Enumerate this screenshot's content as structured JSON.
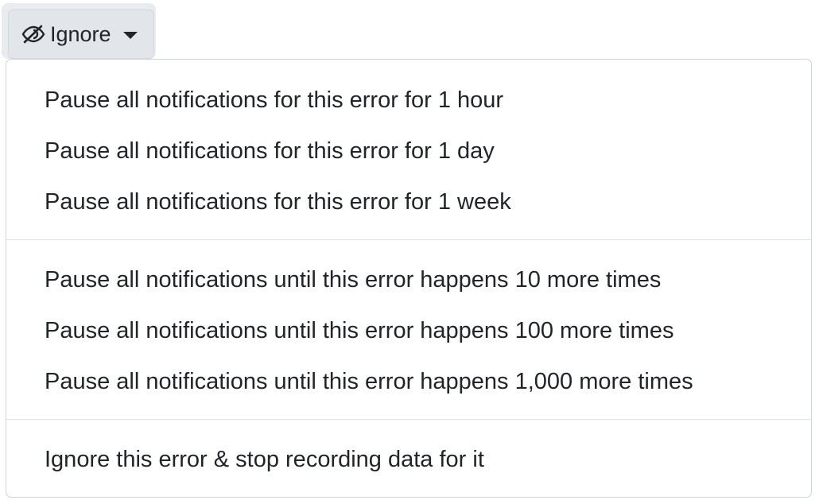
{
  "button": {
    "label": "Ignore",
    "icon": "eye-slash-icon",
    "caret": "caret-down-icon"
  },
  "menu": {
    "groups": [
      {
        "items": [
          "Pause all notifications for this error for 1 hour",
          "Pause all notifications for this error for 1 day",
          "Pause all notifications for this error for 1 week"
        ]
      },
      {
        "items": [
          "Pause all notifications until this error happens 10 more times",
          "Pause all notifications until this error happens 100 more times",
          "Pause all notifications until this error happens 1,000 more times"
        ]
      },
      {
        "items": [
          "Ignore this error & stop recording data for it"
        ]
      }
    ]
  },
  "colors": {
    "text": "#212529",
    "button_bg": "#e2e6ea",
    "border": "#ced4da",
    "divider": "#dfe3e6"
  }
}
